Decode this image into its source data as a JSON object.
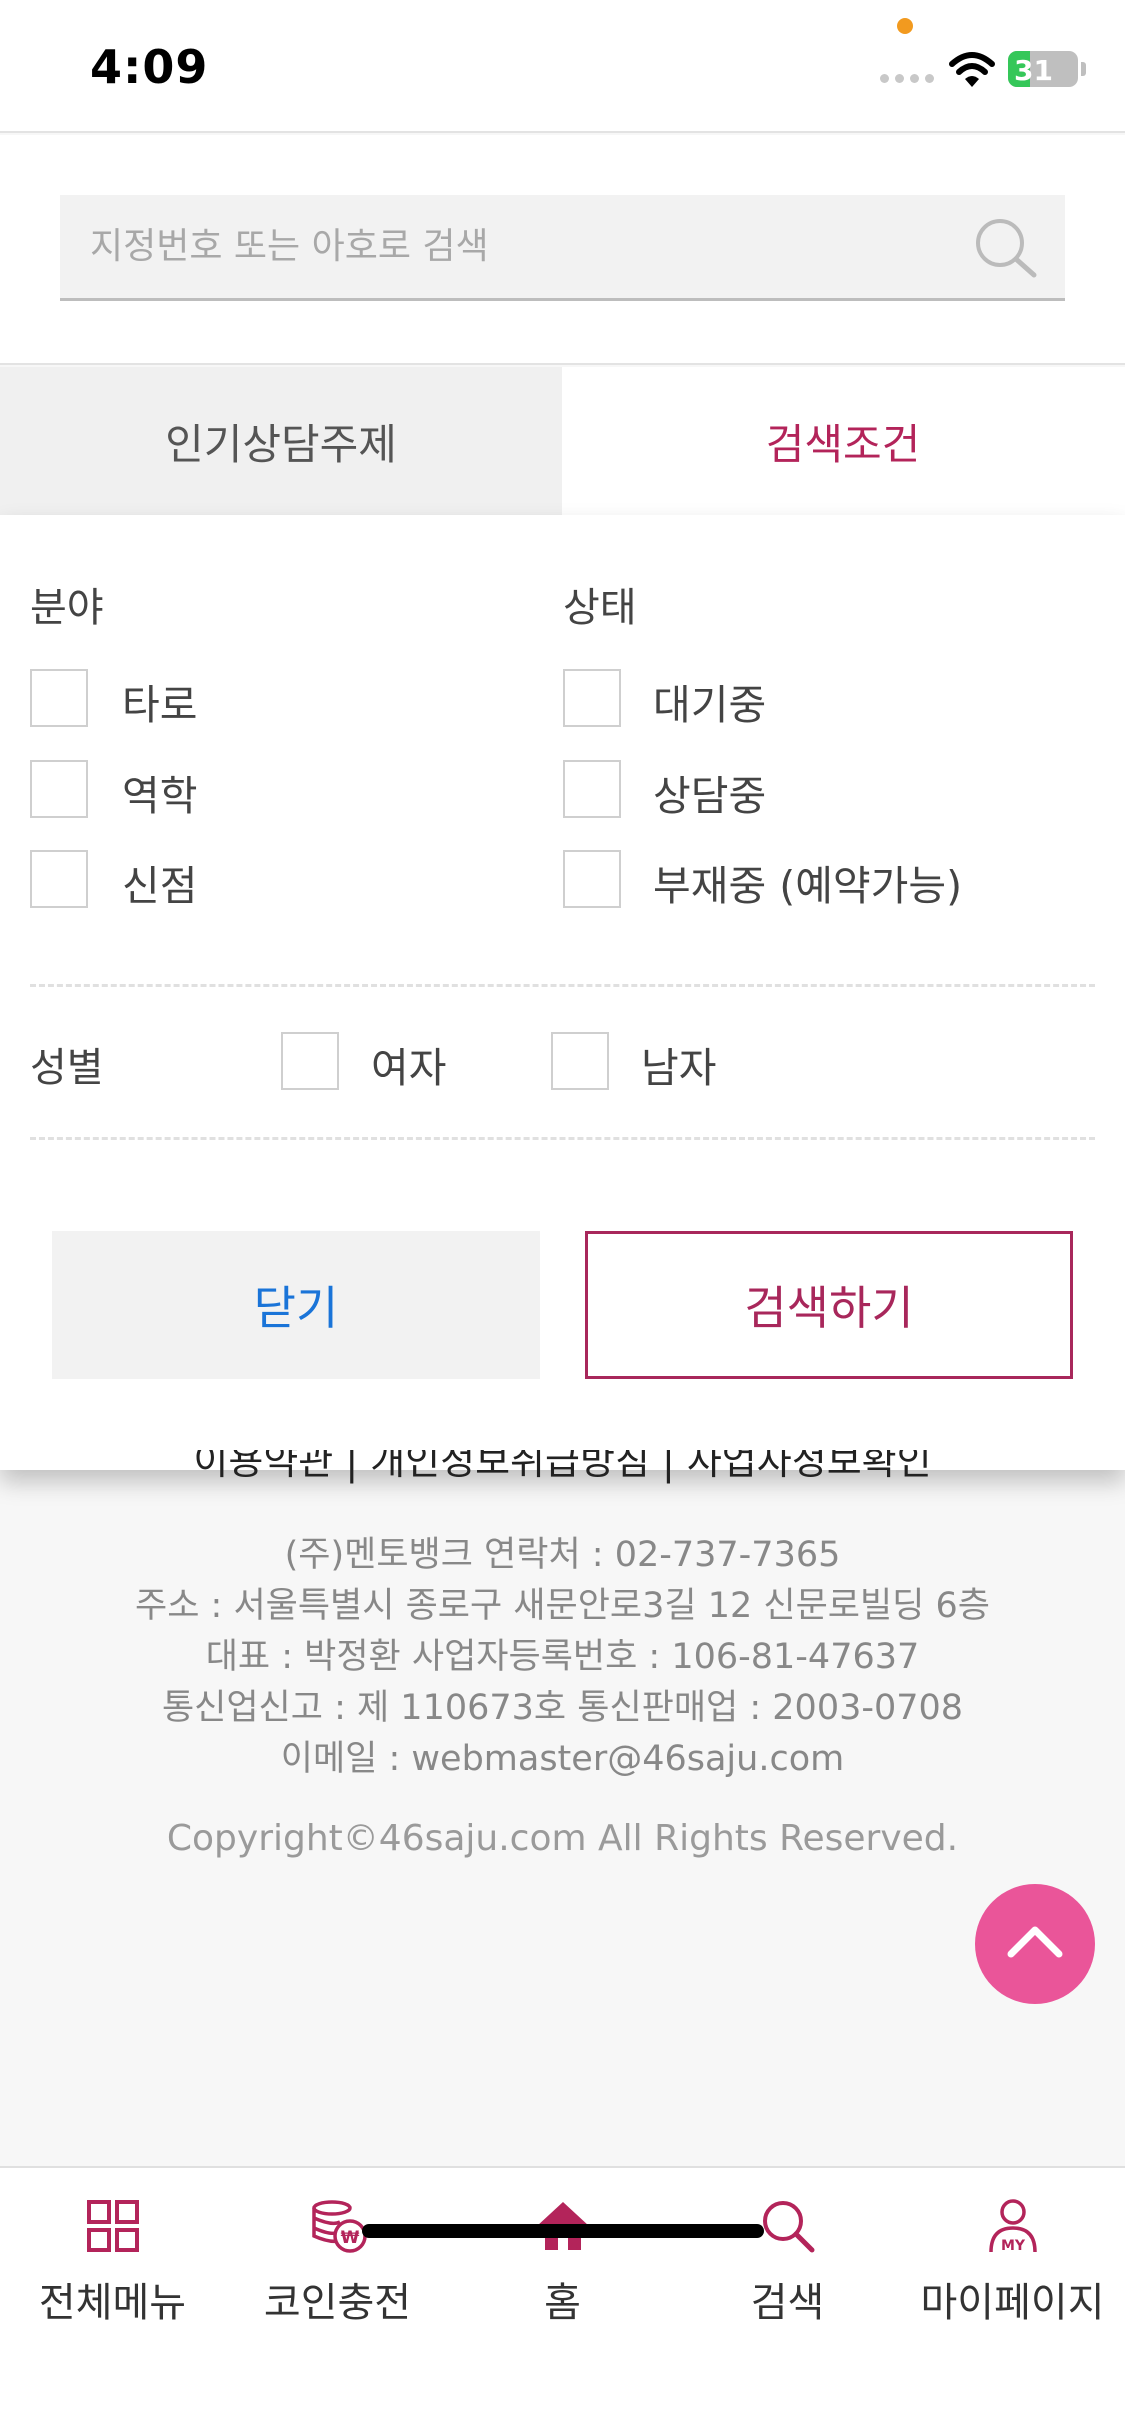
{
  "status": {
    "time": "4:09",
    "battery": "31"
  },
  "search": {
    "placeholder": "지정번호 또는 아호로 검색"
  },
  "tabs": {
    "popular": "인기상담주제",
    "conditions": "검색조건"
  },
  "filters": {
    "field_label": "분야",
    "field_options": [
      "타로",
      "역학",
      "신점"
    ],
    "status_label": "상태",
    "status_options": [
      "대기중",
      "상담중",
      "부재중 (예약가능)"
    ],
    "gender_label": "성별",
    "gender_options": [
      "여자",
      "남자"
    ]
  },
  "buttons": {
    "close": "닫기",
    "search": "검색하기"
  },
  "footer": {
    "links": "이용약관 | 개인정보취급방침 | 사업자정보확인",
    "company": "(주)멘토뱅크 연락처 : 02-737-7365",
    "address": "주소 : 서울특별시 종로구 새문안로3길 12 신문로빌딩 6층",
    "ceo": "대표 : 박정환 사업자등록번호 : 106-81-47637",
    "telecom": "통신업신고 : 제 110673호 통신판매업 : 2003-0708",
    "email": "이메일 : webmaster@46saju.com",
    "copyright": "Copyright©46saju.com All Rights Reserved."
  },
  "nav": {
    "menu": "전체메뉴",
    "coin": "코인충전",
    "home": "홈",
    "search": "검색",
    "mypage": "마이페이지"
  },
  "colors": {
    "accent": "#a8275b",
    "link": "#1a74d8",
    "top_button": "#ea5599"
  }
}
